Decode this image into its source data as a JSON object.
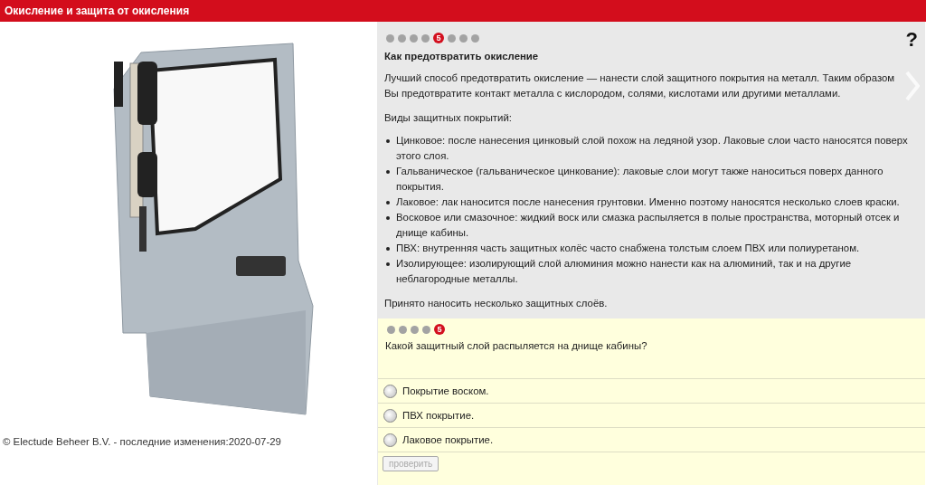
{
  "header": {
    "title": "Окисление и защита от окисления"
  },
  "footer": {
    "copyright": "© Electude Beheer B.V. - последние изменения:2020-07-29"
  },
  "lesson": {
    "pages": [
      {
        "selected": false
      },
      {
        "selected": false
      },
      {
        "selected": false
      },
      {
        "selected": false
      },
      {
        "selected": true,
        "label": "5"
      },
      {
        "selected": false
      },
      {
        "selected": false
      },
      {
        "selected": false
      }
    ],
    "help": "?",
    "heading": "Как предотвратить окисление",
    "intro": "Лучший способ предотвратить окисление — нанести слой защитного покрытия на металл. Таким образом Вы предотвратите контакт металла с кислородом, солями, кислотами или другими металлами.",
    "list_title": "Виды защитных покрытий:",
    "items": [
      "Цинковое: после нанесения цинковый слой похож на ледяной узор. Лаковые слои часто наносятся поверх этого слоя.",
      "Гальваническое (гальваническое цинкование): лаковые слои могут также наноситься поверх данного покрытия.",
      "Лаковое: лак наносится после нанесения грунтовки. Именно поэтому наносятся несколько слоев краски.",
      "Восковое или смазочное: жидкий воск или смазка распыляется в полые пространства, моторный отсек и днище кабины.",
      "ПВХ: внутренняя часть защитных колёс часто снабжена толстым слоем ПВХ или полиуретаном.",
      "Изолирующее: изолирующий слой алюминия можно нанести как на алюминий, так и на другие неблагородные металлы."
    ],
    "closing": "Принято наносить несколько защитных слоёв."
  },
  "quiz": {
    "pages": [
      {
        "selected": false
      },
      {
        "selected": false
      },
      {
        "selected": false
      },
      {
        "selected": false
      },
      {
        "selected": true,
        "label": "5"
      }
    ],
    "question": "Какой защитный слой распыляется на днище кабины?",
    "options": [
      {
        "label": "Покрытие воском.",
        "selected": false
      },
      {
        "label": "ПВХ покрытие.",
        "selected": false
      },
      {
        "label": "Лаковое покрытие.",
        "selected": false
      }
    ],
    "check_button": {
      "label": "проверить",
      "disabled": true
    }
  }
}
